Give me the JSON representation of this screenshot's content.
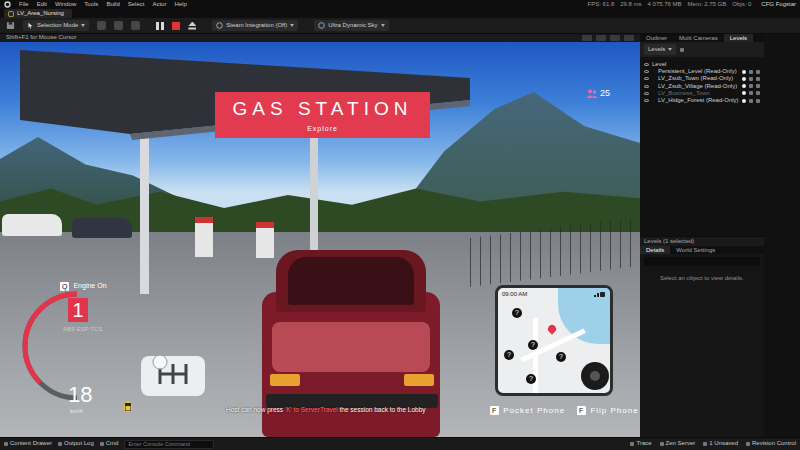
{
  "menu": [
    "File",
    "Edit",
    "Window",
    "Tools",
    "Build",
    "Select",
    "Actor",
    "Help"
  ],
  "stats": [
    "FPS: 61.8",
    "29.8 ms",
    "4 075.76 MB",
    "Mem: 2.75 GB",
    "Objs: 0"
  ],
  "project": "CFG Fogstar",
  "level_tab": "LV_Area_Nursing",
  "toolbar": {
    "mode": "Selection Mode",
    "items": [
      "Steam Integration (Off)",
      "Ultra Dynamic Sky"
    ]
  },
  "viewport": {
    "hint": "Shift+F1 for Mouse Cursor"
  },
  "hud": {
    "location": "GAS STATION",
    "activity": "Explore",
    "players": "25",
    "engine_key": "Q",
    "engine": "Engine On",
    "gear": "1",
    "assists": "ABS  ESP  TCS",
    "speed": "18",
    "unit": "km/h",
    "rpm_level": 0.75,
    "clock": "09:00 AM",
    "markers": [
      "?",
      "?",
      "?",
      "?",
      "?"
    ],
    "message_start": "Host can now press ",
    "message_key": "'K' to ServerTravel",
    "message_end": " the session back to the Lobby",
    "actions": [
      {
        "key": "F",
        "label": "Pocket Phone"
      },
      {
        "key": "F",
        "label": "Flip Phone"
      }
    ]
  },
  "outliner": {
    "tabs": [
      {
        "label": "Outliner",
        "selected": false
      },
      {
        "label": "Multi Cameras",
        "selected": false
      },
      {
        "label": "Levels",
        "selected": true
      }
    ],
    "levels_button": "Levels",
    "header": "Level",
    "rows": [
      {
        "name": "Persistent_Level (Read-Only)",
        "loaded": true
      },
      {
        "name": "LV_Zsub_Town (Read-Only)",
        "loaded": true
      },
      {
        "name": "LV_Zsub_Village (Read-Only)",
        "loaded": true
      },
      {
        "name": "LV_Business_Town",
        "loaded": false
      },
      {
        "name": "LV_Hidge_Forest (Read-Only)",
        "loaded": true
      }
    ],
    "footer": "Levels (1 selected)"
  },
  "details": {
    "tabs": [
      {
        "label": "Details",
        "selected": true
      },
      {
        "label": "World Settings",
        "selected": false
      }
    ],
    "empty": "Select an object to view details."
  },
  "status_bar": {
    "left": [
      "Content Drawer",
      "Output Log",
      "Cmd"
    ],
    "console_placeholder": "Enter Console Command",
    "right": [
      "Trace",
      "Zen Server",
      "1 Unsaved",
      "Revision Control"
    ]
  }
}
